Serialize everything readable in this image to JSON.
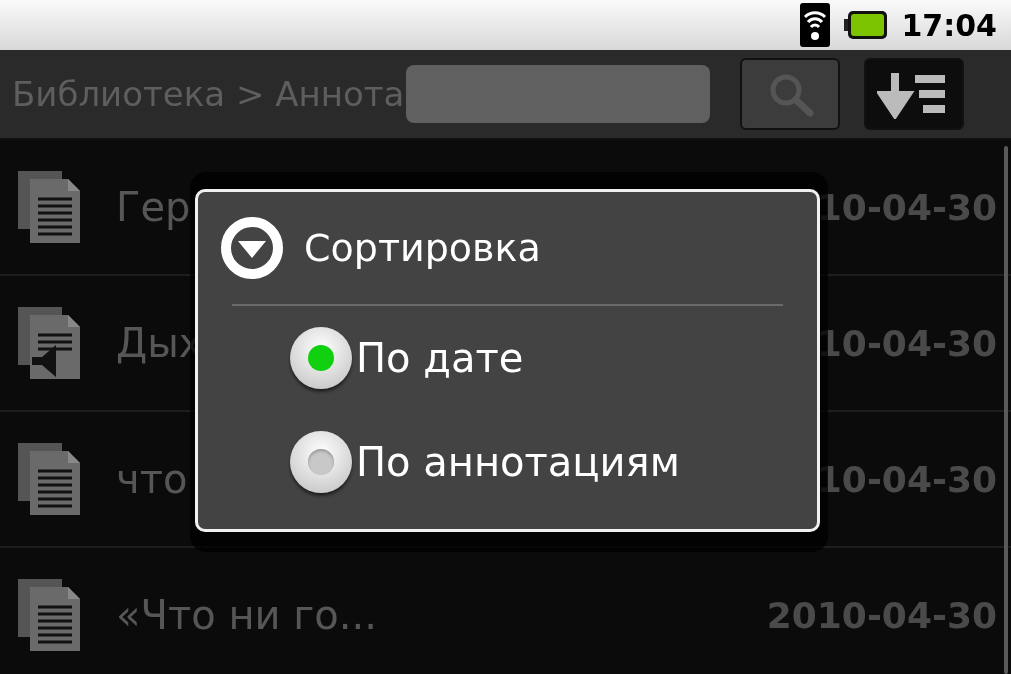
{
  "status_bar": {
    "time": "17:04"
  },
  "title_bar": {
    "breadcrumb": "Библиотека > Аннота"
  },
  "list": [
    {
      "kind": "text",
      "title": "Гер",
      "date": "10-04-30"
    },
    {
      "kind": "audio",
      "title": "Дых",
      "date": "10-04-30"
    },
    {
      "kind": "text",
      "title": "что",
      "date": "10-04-30"
    },
    {
      "kind": "text",
      "title": "«Что ни го...",
      "date": "2010-04-30"
    }
  ],
  "dialog": {
    "title": "Сортировка",
    "options": [
      {
        "label": "По дате",
        "selected": true
      },
      {
        "label": "По аннотациям",
        "selected": false
      }
    ]
  }
}
